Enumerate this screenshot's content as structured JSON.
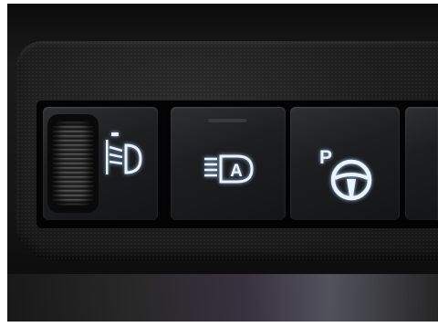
{
  "scene": {
    "subject": "car-dashboard-switch-panel",
    "colors": {
      "backlight": "#e8f3ff",
      "trim": "#1a1a1a",
      "panel": "#050505"
    }
  },
  "switches": [
    {
      "name": "headlight-leveling",
      "icon": "headlight-level-icon"
    },
    {
      "name": "auto-high-beam",
      "icon": "auto-high-beam-icon",
      "symbol": "A"
    },
    {
      "name": "parking-steering-assist",
      "icon": "parking-steering-icon",
      "symbol": "P"
    },
    {
      "name": "unknown-switch",
      "icon": ""
    }
  ]
}
